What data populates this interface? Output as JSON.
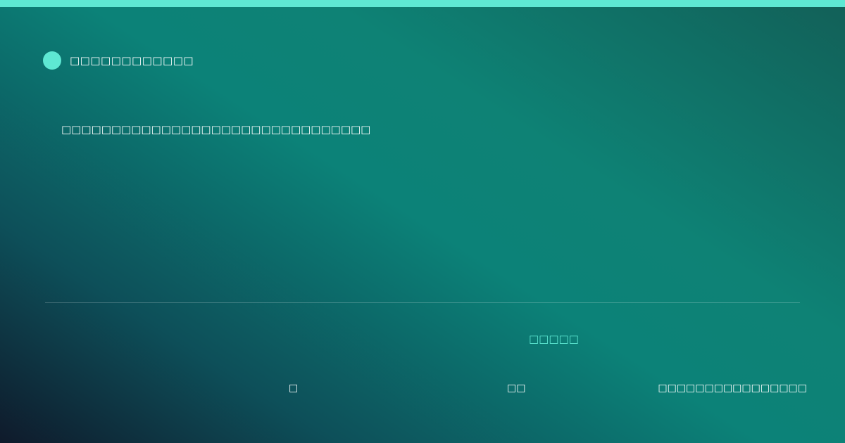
{
  "brand": {
    "icon": "brand-dot-icon",
    "name": "□□□□□□□□□□□□"
  },
  "headline": "□□□□□□□□□□□□□□□□□□□□□□□□□□□□□□□",
  "accent_label": "□□□□□",
  "footer": {
    "item_1": "□",
    "item_2": "□□",
    "item_3": "□□□□□□□□□□□□□□□□"
  },
  "colors": {
    "accent": "#5ee8d3",
    "background_dark": "#0f1a2b",
    "background_teal": "#0c8278"
  }
}
